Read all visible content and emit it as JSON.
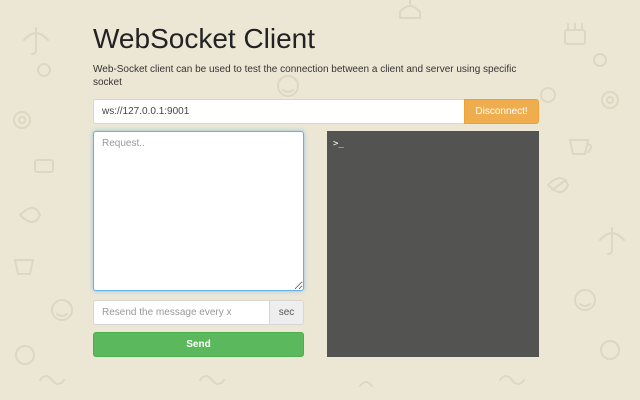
{
  "page": {
    "title": "WebSocket Client",
    "description": "Web-Socket client can be used to test the connection between a client and server using specific socket"
  },
  "connection": {
    "url_value": "ws://127.0.0.1:9001",
    "disconnect_label": "Disconnect!"
  },
  "request": {
    "placeholder": "Request.."
  },
  "resend": {
    "placeholder": "Resend the message every x",
    "unit_label": "sec"
  },
  "send_label": "Send",
  "console": {
    "prompt": ">_"
  },
  "colors": {
    "background": "#ece7d5",
    "doodle": "#ddd6c2",
    "disconnect": "#f0ad4e",
    "send": "#5cb85c",
    "console": "#535351"
  }
}
